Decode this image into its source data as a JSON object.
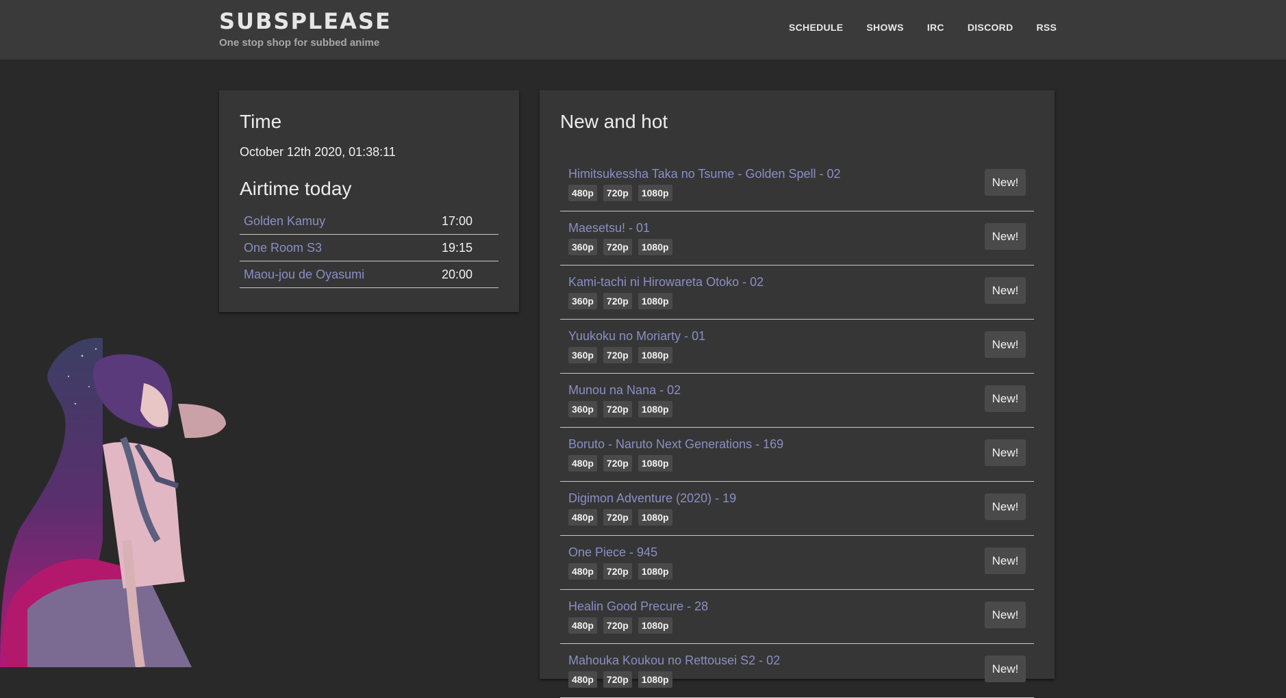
{
  "header": {
    "title": "SUBSPLEASE",
    "subtitle": "One stop shop for subbed anime",
    "nav": [
      "SCHEDULE",
      "SHOWS",
      "IRC",
      "DISCORD",
      "RSS"
    ]
  },
  "time_panel": {
    "title": "Time",
    "current_time": "October 12th 2020, 01:38:11",
    "airtime_title": "Airtime today",
    "airtimes": [
      {
        "show": "Golden Kamuy",
        "time": "17:00"
      },
      {
        "show": "One Room S3",
        "time": "19:15"
      },
      {
        "show": "Maou-jou de Oyasumi",
        "time": "20:00"
      }
    ]
  },
  "new_and_hot": {
    "title": "New and hot",
    "new_label": "New!",
    "releases": [
      {
        "title": "Himitsukessha Taka no Tsume - Golden Spell - 02",
        "qualities": [
          "480p",
          "720p",
          "1080p"
        ]
      },
      {
        "title": "Maesetsu! - 01",
        "qualities": [
          "360p",
          "720p",
          "1080p"
        ]
      },
      {
        "title": "Kami-tachi ni Hirowareta Otoko - 02",
        "qualities": [
          "360p",
          "720p",
          "1080p"
        ]
      },
      {
        "title": "Yuukoku no Moriarty - 01",
        "qualities": [
          "360p",
          "720p",
          "1080p"
        ]
      },
      {
        "title": "Munou na Nana - 02",
        "qualities": [
          "360p",
          "720p",
          "1080p"
        ]
      },
      {
        "title": "Boruto - Naruto Next Generations - 169",
        "qualities": [
          "480p",
          "720p",
          "1080p"
        ]
      },
      {
        "title": "Digimon Adventure (2020) - 19",
        "qualities": [
          "480p",
          "720p",
          "1080p"
        ]
      },
      {
        "title": "One Piece - 945",
        "qualities": [
          "480p",
          "720p",
          "1080p"
        ]
      },
      {
        "title": "Healin Good Precure - 28",
        "qualities": [
          "480p",
          "720p",
          "1080p"
        ]
      },
      {
        "title": "Mahouka Koukou no Rettousei S2 - 02",
        "qualities": [
          "480p",
          "720p",
          "1080p"
        ]
      }
    ]
  },
  "colors": {
    "page_bg": "#292929",
    "header_bg": "#3a3a3a",
    "card_bg": "#363636",
    "link": "#8a8fc4",
    "badge_bg": "#4a4a4a"
  }
}
